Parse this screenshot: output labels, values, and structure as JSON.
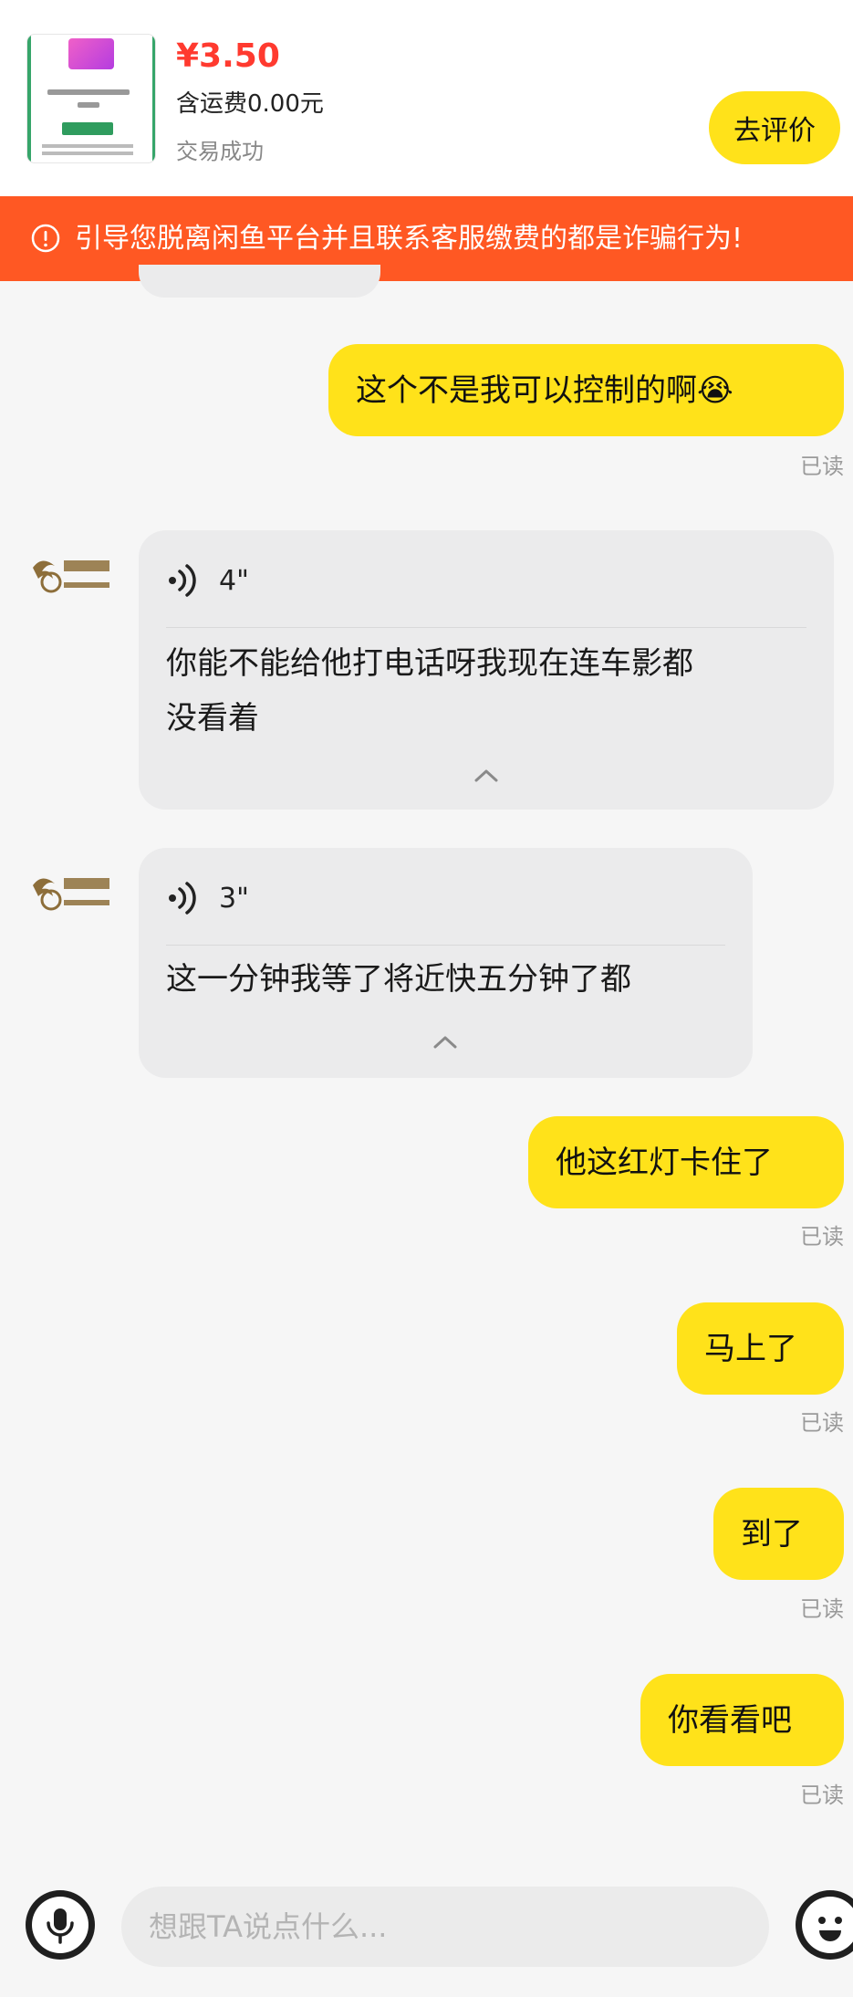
{
  "product": {
    "price": "¥3.50",
    "shipping": "含运费0.00元",
    "status": "交易成功",
    "review_label": "去评价"
  },
  "warning": {
    "text": "引导您脱离闲鱼平台并且联系客服缴费的都是诈骗行为!"
  },
  "messages": [
    {
      "type": "text",
      "side": "out",
      "text": "这个不是我可以控制的啊😭",
      "read": "已读"
    },
    {
      "type": "voice",
      "side": "in",
      "duration": "4\"",
      "transcript_lines": [
        "你能不能给他打电话呀我现在连车影都",
        "没看着"
      ]
    },
    {
      "type": "voice",
      "side": "in",
      "duration": "3\"",
      "transcript_lines": [
        "这一分钟我等了将近快五分钟了都"
      ]
    },
    {
      "type": "text",
      "side": "out",
      "text": "他这红灯卡住了",
      "read": "已读"
    },
    {
      "type": "text",
      "side": "out",
      "text": "马上了",
      "read": "已读"
    },
    {
      "type": "text",
      "side": "out",
      "text": "到了",
      "read": "已读"
    },
    {
      "type": "text",
      "side": "out",
      "text": "你看看吧",
      "read": "已读"
    }
  ],
  "input": {
    "placeholder": "想跟TA说点什么..."
  },
  "colors": {
    "accent_yellow": "#ffe21a",
    "warning_orange": "#ff5823",
    "price_red": "#ff3a2f",
    "incoming_bubble": "#ebebec"
  },
  "icons": {
    "warning": "exclamation-circle-icon",
    "voice": "sound-wave-icon",
    "collapse": "chevron-up-icon",
    "mic": "microphone-icon",
    "emoji": "smiley-icon",
    "avatar": "seller-logo-avatar"
  }
}
